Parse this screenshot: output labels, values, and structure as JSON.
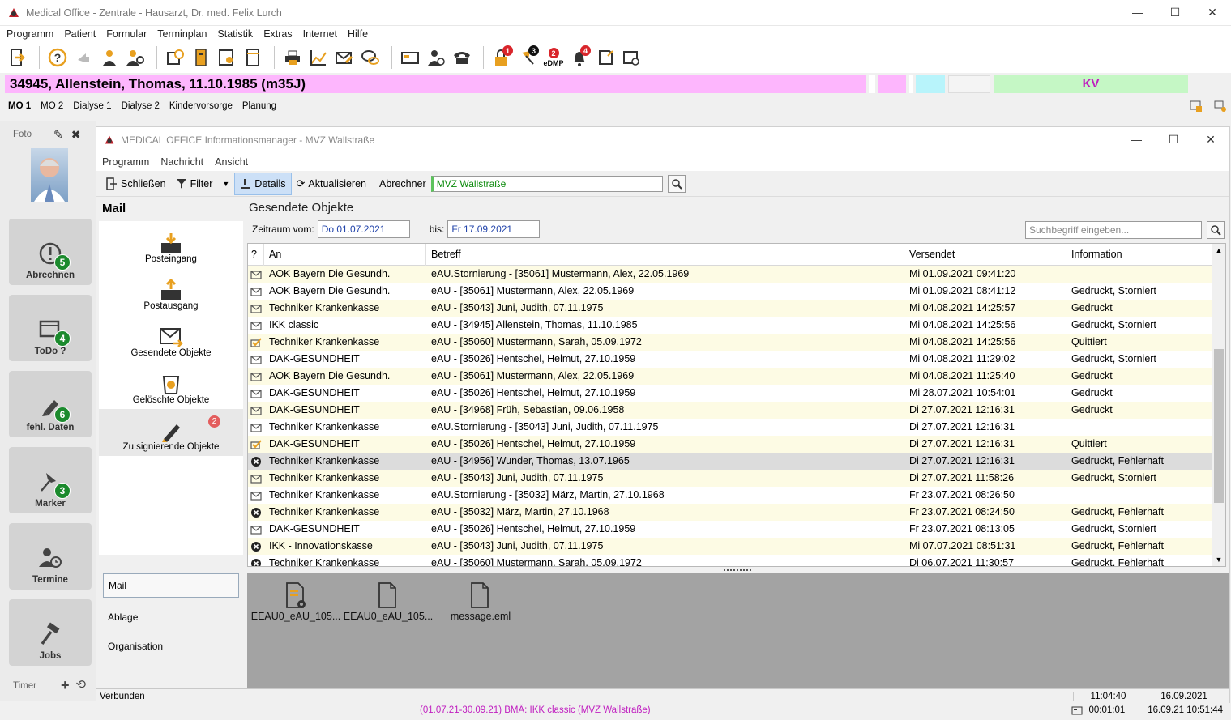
{
  "window": {
    "title": "Medical Office - Zentrale - Hausarzt, Dr. med. Felix Lurch"
  },
  "menu": [
    "Programm",
    "Patient",
    "Formular",
    "Terminplan",
    "Statistik",
    "Extras",
    "Internet",
    "Hilfe"
  ],
  "toolbar_badges": {
    "b1": "1",
    "b2": "3",
    "b3": "2",
    "b3_label": "eDMP",
    "b4": "4"
  },
  "patient": {
    "name": "34945, Allenstein, Thomas, 11.10.1985 (m35J)",
    "insurance_tag": "KV"
  },
  "tabs": [
    "MO 1",
    "MO 2",
    "Dialyse 1",
    "Dialyse 2",
    "Kindervorsorge",
    "Planung"
  ],
  "foto_label": "Foto",
  "tiles": [
    {
      "label": "Abrechnen",
      "count": "5"
    },
    {
      "label": "ToDo ?",
      "count": "4"
    },
    {
      "label": "fehl. Daten",
      "count": "6"
    },
    {
      "label": "Marker",
      "count": "3"
    },
    {
      "label": "Termine",
      "count": ""
    },
    {
      "label": "Jobs",
      "count": ""
    }
  ],
  "timer_label": "Timer",
  "inner": {
    "title": "MEDICAL OFFICE Informationsmanager - MVZ Wallstraße",
    "menu": [
      "Programm",
      "Nachricht",
      "Ansicht"
    ],
    "toolbar": {
      "close": "Schließen",
      "filter": "Filter",
      "details": "Details",
      "refresh": "Aktualisieren",
      "abrechner_label": "Abrechner",
      "abrechner_value": "MVZ Wallstraße"
    },
    "mail_head": "Mail",
    "folders": [
      {
        "label": "Posteingang"
      },
      {
        "label": "Postausgang"
      },
      {
        "label": "Gesendete Objekte"
      },
      {
        "label": "Gelöschte Objekte"
      },
      {
        "label": "Zu signierende Objekte",
        "badge": "2"
      }
    ],
    "sections": [
      "Mail",
      "Ablage",
      "Organisation"
    ],
    "content_head": "Gesendete Objekte",
    "filter": {
      "from_label": "Zeitraum vom:",
      "from": "Do 01.07.2021",
      "to_label": "bis:",
      "to": "Fr 17.09.2021",
      "search_placeholder": "Suchbegriff eingeben..."
    },
    "columns": [
      "?",
      "An",
      "Betreff",
      "Versendet",
      "Information"
    ],
    "rows": [
      {
        "icon": "envelope",
        "an": "AOK Bayern Die Gesundh.",
        "betreff": "eAU.Stornierung - [35061] Mustermann, Alex, 22.05.1969",
        "versendet": "Mi 01.09.2021 09:41:20",
        "info": ""
      },
      {
        "icon": "envelope",
        "an": "AOK Bayern Die Gesundh.",
        "betreff": "eAU - [35061] Mustermann, Alex, 22.05.1969",
        "versendet": "Mi 01.09.2021 08:41:12",
        "info": "Gedruckt, Storniert"
      },
      {
        "icon": "envelope",
        "an": "Techniker Krankenkasse",
        "betreff": "eAU - [35043] Juni, Judith, 07.11.1975",
        "versendet": "Mi 04.08.2021 14:25:57",
        "info": "Gedruckt"
      },
      {
        "icon": "envelope",
        "an": "IKK classic",
        "betreff": "eAU - [34945] Allenstein, Thomas, 11.10.1985",
        "versendet": "Mi 04.08.2021 14:25:56",
        "info": "Gedruckt, Storniert"
      },
      {
        "icon": "check",
        "an": "Techniker Krankenkasse",
        "betreff": "eAU - [35060] Mustermann, Sarah, 05.09.1972",
        "versendet": "Mi 04.08.2021 14:25:56",
        "info": "Quittiert"
      },
      {
        "icon": "envelope",
        "an": "DAK-GESUNDHEIT",
        "betreff": "eAU - [35026] Hentschel, Helmut, 27.10.1959",
        "versendet": "Mi 04.08.2021 11:29:02",
        "info": "Gedruckt, Storniert"
      },
      {
        "icon": "envelope",
        "an": "AOK Bayern Die Gesundh.",
        "betreff": "eAU - [35061] Mustermann, Alex, 22.05.1969",
        "versendet": "Mi 04.08.2021 11:25:40",
        "info": "Gedruckt"
      },
      {
        "icon": "envelope",
        "an": "DAK-GESUNDHEIT",
        "betreff": "eAU - [35026] Hentschel, Helmut, 27.10.1959",
        "versendet": "Mi 28.07.2021 10:54:01",
        "info": "Gedruckt"
      },
      {
        "icon": "envelope",
        "an": "DAK-GESUNDHEIT",
        "betreff": "eAU - [34968] Früh, Sebastian, 09.06.1958",
        "versendet": "Di 27.07.2021 12:16:31",
        "info": "Gedruckt"
      },
      {
        "icon": "envelope",
        "an": "Techniker Krankenkasse",
        "betreff": "eAU.Stornierung - [35043] Juni, Judith, 07.11.1975",
        "versendet": "Di 27.07.2021 12:16:31",
        "info": ""
      },
      {
        "icon": "check",
        "an": "DAK-GESUNDHEIT",
        "betreff": "eAU - [35026] Hentschel, Helmut, 27.10.1959",
        "versendet": "Di 27.07.2021 12:16:31",
        "info": "Quittiert"
      },
      {
        "icon": "error",
        "an": "Techniker Krankenkasse",
        "betreff": "eAU - [34956] Wunder, Thomas, 13.07.1965",
        "versendet": "Di 27.07.2021 12:16:31",
        "info": "Gedruckt, Fehlerhaft"
      },
      {
        "icon": "envelope",
        "an": "Techniker Krankenkasse",
        "betreff": "eAU - [35043] Juni, Judith, 07.11.1975",
        "versendet": "Di 27.07.2021 11:58:26",
        "info": "Gedruckt, Storniert"
      },
      {
        "icon": "envelope",
        "an": "Techniker Krankenkasse",
        "betreff": "eAU.Stornierung - [35032] März, Martin, 27.10.1968",
        "versendet": "Fr 23.07.2021 08:26:50",
        "info": ""
      },
      {
        "icon": "error",
        "an": "Techniker Krankenkasse",
        "betreff": "eAU - [35032] März, Martin, 27.10.1968",
        "versendet": "Fr 23.07.2021 08:24:50",
        "info": "Gedruckt, Fehlerhaft"
      },
      {
        "icon": "envelope",
        "an": "DAK-GESUNDHEIT",
        "betreff": "eAU - [35026] Hentschel, Helmut, 27.10.1959",
        "versendet": "Fr 23.07.2021 08:13:05",
        "info": "Gedruckt, Storniert"
      },
      {
        "icon": "error",
        "an": "IKK - Innovationskasse",
        "betreff": "eAU - [35043] Juni, Judith, 07.11.1975",
        "versendet": "Mi 07.07.2021 08:51:31",
        "info": "Gedruckt, Fehlerhaft"
      },
      {
        "icon": "error",
        "an": "Techniker Krankenkasse",
        "betreff": "eAU - [35060] Mustermann, Sarah, 05.09.1972",
        "versendet": "Di 06.07.2021 11:30:57",
        "info": "Gedruckt, Fehlerhaft"
      }
    ],
    "attachments": [
      {
        "name": "EEAU0_eAU_105..."
      },
      {
        "name": "EEAU0_eAU_105..."
      },
      {
        "name": "message.eml"
      }
    ],
    "status": {
      "left": "Verbunden",
      "time": "11:04:40",
      "date": "16.09.2021"
    }
  },
  "bottom": {
    "info": "(01.07.21-30.09.21) BMÄ: IKK classic (MVZ Wallstraße)",
    "timer": "00:01:01",
    "datetime": "16.09.21 10:51:44"
  }
}
